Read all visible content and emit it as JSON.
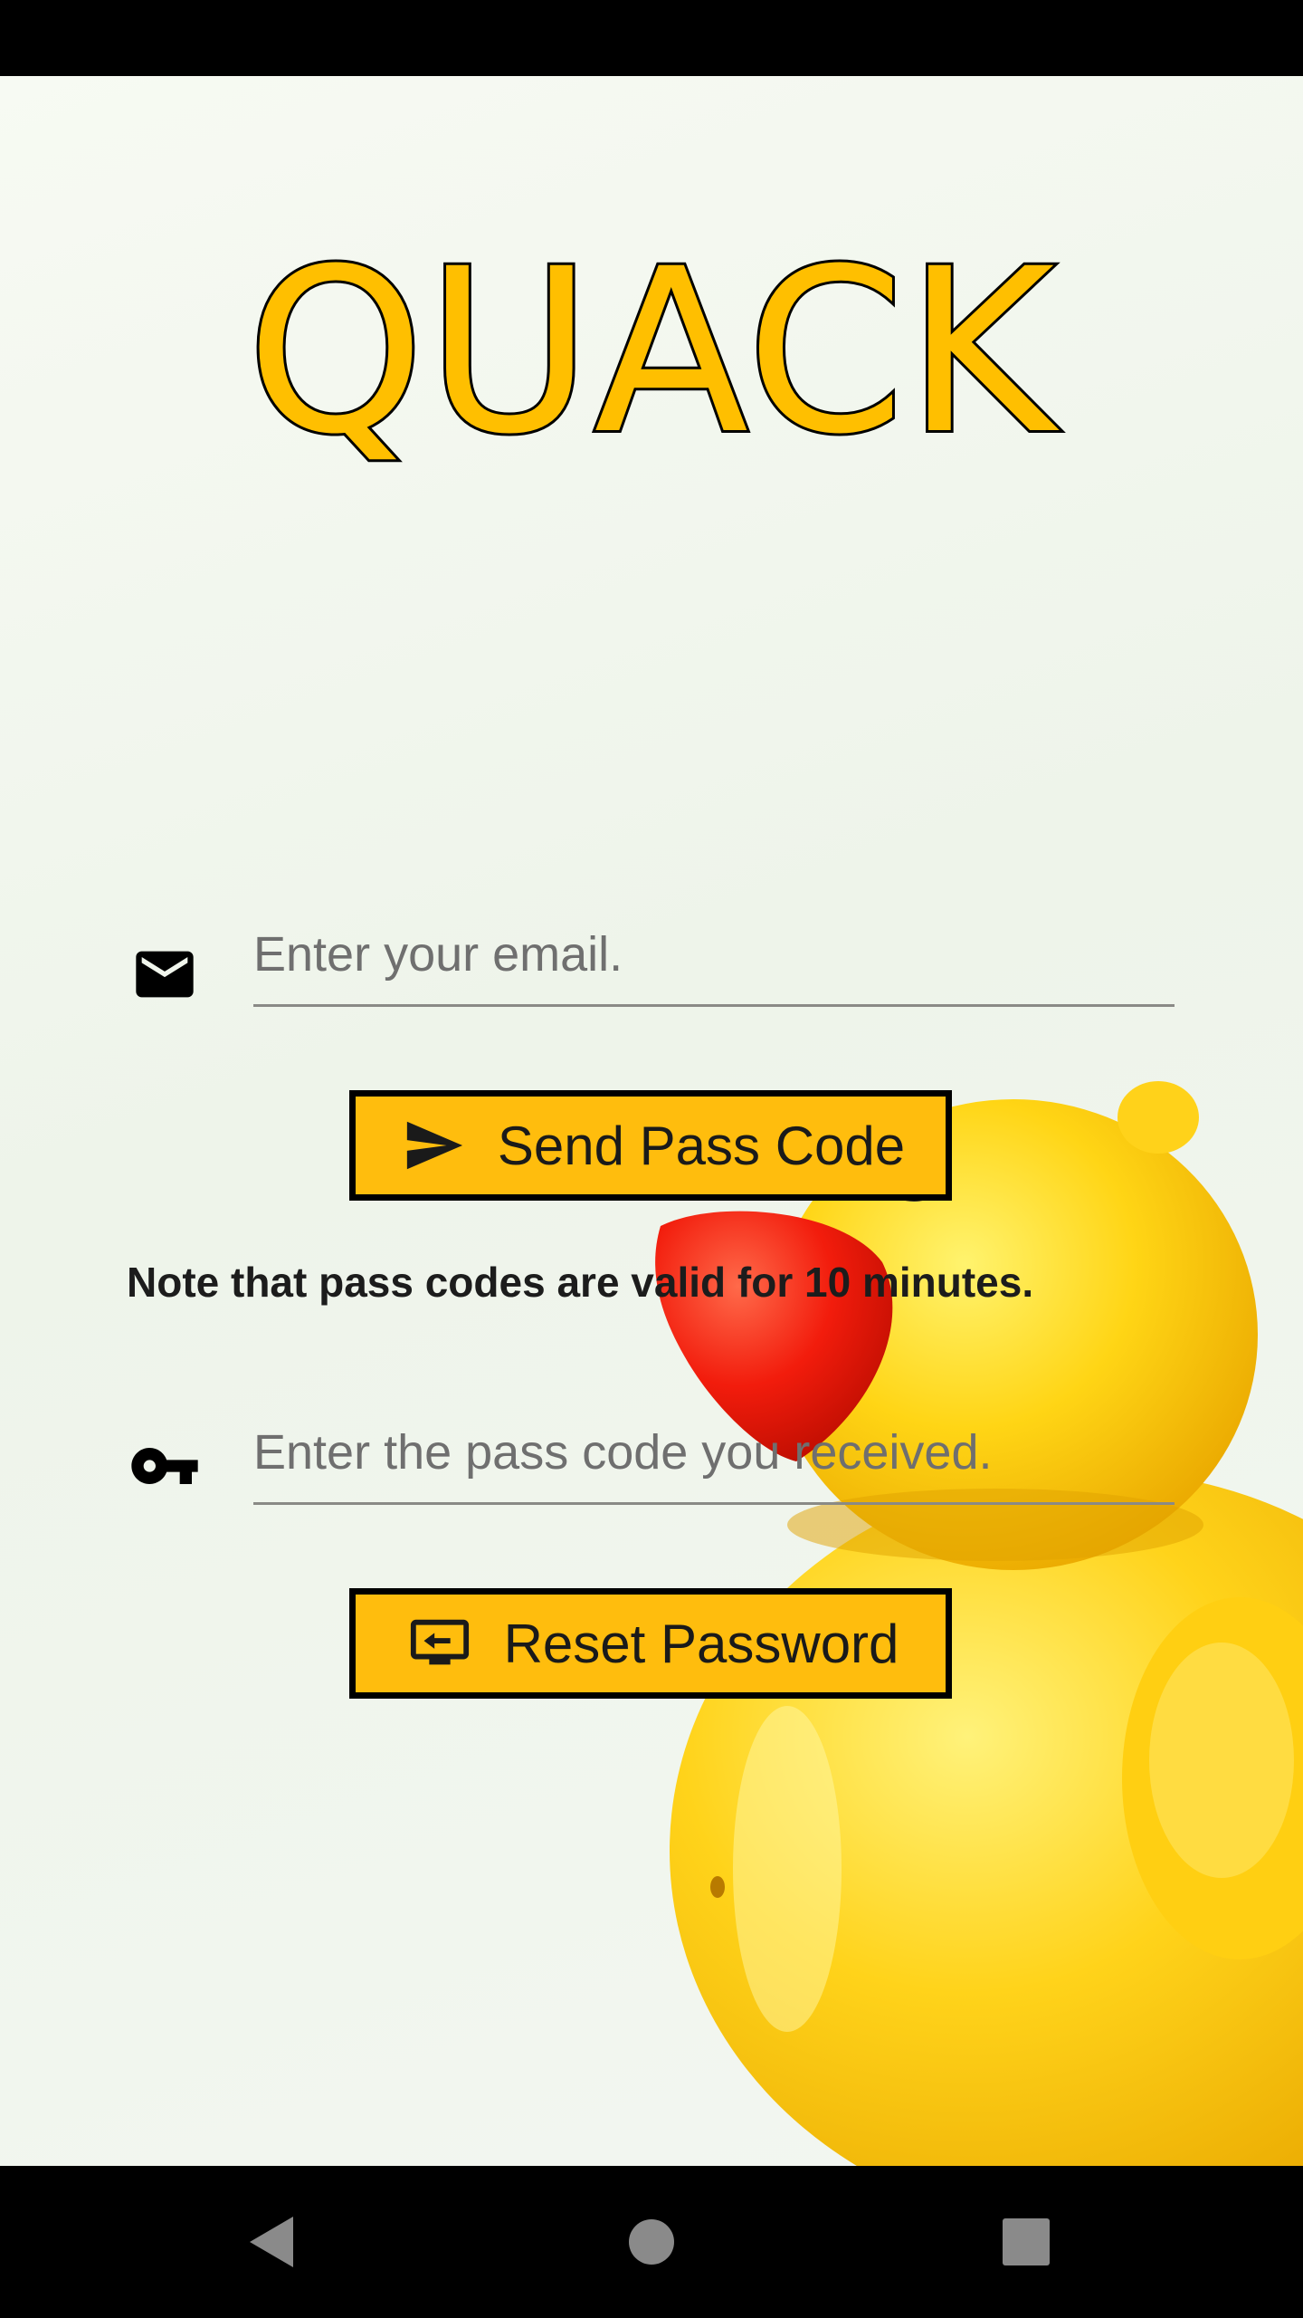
{
  "app": {
    "title": "QUACK"
  },
  "email_field": {
    "icon": "email-icon",
    "placeholder": "Enter your email.",
    "value": ""
  },
  "send_button": {
    "icon": "send-icon",
    "label": "Send Pass Code"
  },
  "note": "Note that pass codes are valid for 10 minutes.",
  "passcode_field": {
    "icon": "key-icon",
    "placeholder": "Enter the pass code you received.",
    "value": ""
  },
  "reset_button": {
    "icon": "screen-switch-icon",
    "label": "Reset Password"
  },
  "nav": {
    "back_icon": "back-triangle-icon",
    "home_icon": "home-circle-icon",
    "recents_icon": "recents-square-icon"
  },
  "colors": {
    "accent": "#ffbd0d",
    "outline": "#000000",
    "background": "#f3f7ef"
  }
}
